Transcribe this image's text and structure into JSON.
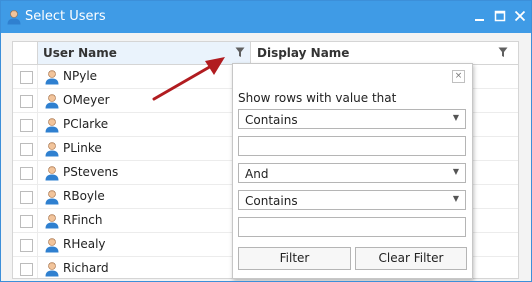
{
  "window": {
    "title": "Select Users",
    "accent_color": "#3f9be6",
    "controls": [
      "minimize-icon",
      "maximize-icon",
      "close-icon"
    ]
  },
  "grid": {
    "columns": [
      {
        "label": "User Name",
        "icon": "filter-funnel-icon"
      },
      {
        "label": "Display Name",
        "icon": "filter-funnel-icon"
      }
    ],
    "rows": [
      {
        "user_name": "NPyle",
        "display_name": ""
      },
      {
        "user_name": "OMeyer",
        "display_name": ""
      },
      {
        "user_name": "PClarke",
        "display_name": ""
      },
      {
        "user_name": "PLinke",
        "display_name": ""
      },
      {
        "user_name": "PStevens",
        "display_name": ""
      },
      {
        "user_name": "RBoyle",
        "display_name": ""
      },
      {
        "user_name": "RFinch",
        "display_name": ""
      },
      {
        "user_name": "RHealy",
        "display_name": ""
      },
      {
        "user_name": "Richard",
        "display_name": ""
      }
    ]
  },
  "filter_popup": {
    "title": "Show rows with value that",
    "operator1": "Contains",
    "value1": "",
    "logic": "And",
    "operator2": "Contains",
    "value2": "",
    "filter_label": "Filter",
    "clear_label": "Clear Filter",
    "close_glyph": "×"
  },
  "annotation": {
    "color": "#b11c20",
    "icon": "red-arrow-icon"
  }
}
